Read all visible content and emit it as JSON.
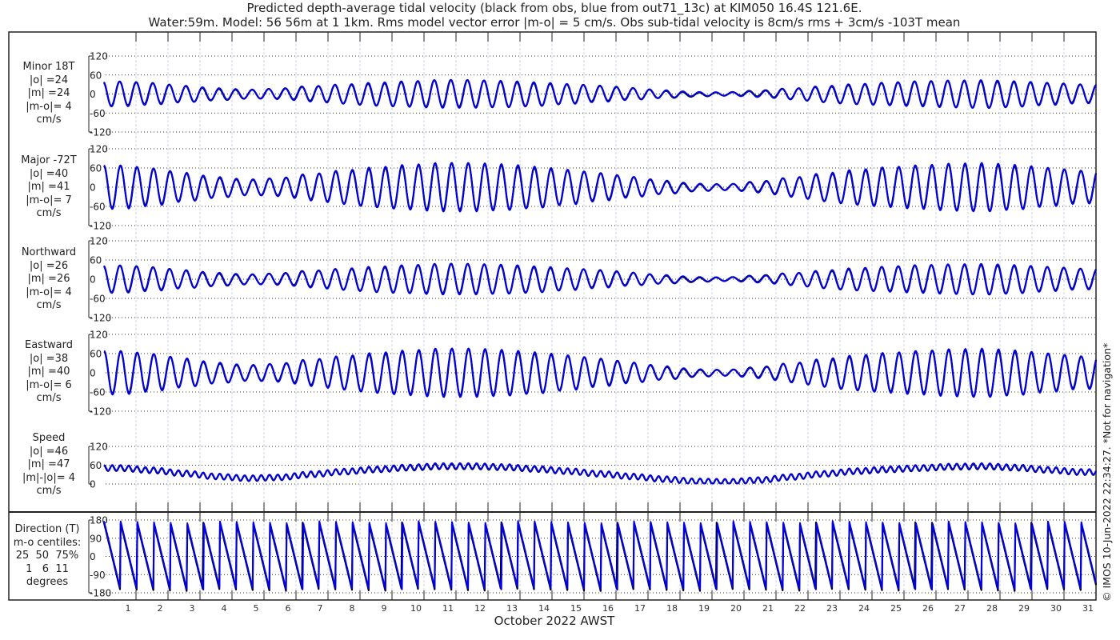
{
  "chart_data": {
    "type": "line",
    "title_line1": "Predicted depth-average tidal velocity (black from obs, blue from out71_13c) at KIM050 16.4S 121.6E.",
    "title_line2": "Water:59m. Model: 56 56m at 1 1km. Rms model vector error |m-o| = 5 cm/s. Obs sub-tidal velocity is 8cm/s rms + 3cm/s -103T mean",
    "xlabel": "October 2022 AWST",
    "x_ticks": [
      "1",
      "2",
      "3",
      "4",
      "5",
      "6",
      "7",
      "8",
      "9",
      "10",
      "11",
      "12",
      "13",
      "14",
      "15",
      "16",
      "17",
      "18",
      "19",
      "20",
      "21",
      "22",
      "23",
      "24",
      "25",
      "26",
      "27",
      "28",
      "29",
      "30",
      "31"
    ],
    "xlim_days": [
      0,
      31
    ],
    "tidal_period_hours": 12.42,
    "daily_envelope_cm_s": [
      72,
      62,
      48,
      34,
      26,
      30,
      44,
      56,
      66,
      74,
      80,
      80,
      76,
      68,
      58,
      46,
      34,
      22,
      12,
      10,
      18,
      32,
      46,
      58,
      66,
      72,
      78,
      80,
      74,
      64,
      54
    ],
    "series_colors": {
      "obs": "#000000",
      "model": "#0000ee"
    },
    "credit": "© IMOS 10-Jun-2022 22:34:27. *Not for navigation*",
    "panels": [
      {
        "key": "minor",
        "lines": [
          "Minor 18T",
          "|o| =24",
          "|m| =24",
          "|m-o|= 4",
          "cm/s"
        ],
        "ylim": [
          -120,
          120
        ],
        "yticks": [
          "120",
          "60",
          "0",
          "-60",
          "-120"
        ],
        "yvals": [
          120,
          60,
          0,
          -60,
          -120
        ],
        "gain": 0.55,
        "phase": 0.3
      },
      {
        "key": "major",
        "lines": [
          "Major -72T",
          "|o| =40",
          "|m| =41",
          "|m-o|= 7",
          "cm/s"
        ],
        "ylim": [
          -120,
          120
        ],
        "yticks": [
          "120",
          "60",
          "0",
          "-60",
          "-120"
        ],
        "yvals": [
          120,
          60,
          0,
          -60,
          -120
        ],
        "gain": 0.95,
        "phase": 0.0
      },
      {
        "key": "northward",
        "lines": [
          "Northward",
          "|o| =26",
          "|m| =26",
          "|m-o|= 4",
          "cm/s"
        ],
        "ylim": [
          -120,
          120
        ],
        "yticks": [
          "120",
          "60",
          "0",
          "-60",
          "-120"
        ],
        "yvals": [
          120,
          60,
          0,
          -60,
          -120
        ],
        "gain": 0.6,
        "phase": 0.2
      },
      {
        "key": "eastward",
        "lines": [
          "Eastward",
          "|o| =38",
          "|m| =40",
          "|m-o|= 6",
          "cm/s"
        ],
        "ylim": [
          -120,
          120
        ],
        "yticks": [
          "120",
          "60",
          "0",
          "-60",
          "-120"
        ],
        "yvals": [
          120,
          60,
          0,
          -60,
          -120
        ],
        "gain": 0.95,
        "phase": -0.1
      },
      {
        "key": "speed",
        "lines": [
          "Speed",
          "|o| =46",
          "|m| =47",
          "|m|-|o|= 4",
          "cm/s"
        ],
        "ylim": [
          0,
          120
        ],
        "yticks": [
          "120",
          "60",
          "0"
        ],
        "yvals": [
          120,
          60,
          0
        ],
        "gain": 0.8,
        "phase": 0.0
      },
      {
        "key": "direction",
        "lines": [
          "Direction (T)",
          "m-o centiles:",
          "25  50  75%",
          "1   6  11",
          "degrees"
        ],
        "ylim": [
          -180,
          180
        ],
        "yticks": [
          "180",
          "90",
          "0",
          "-90",
          "-180"
        ],
        "yvals": [
          180,
          90,
          0,
          -90,
          -180
        ],
        "gain": 1,
        "phase": 0.0
      }
    ]
  }
}
